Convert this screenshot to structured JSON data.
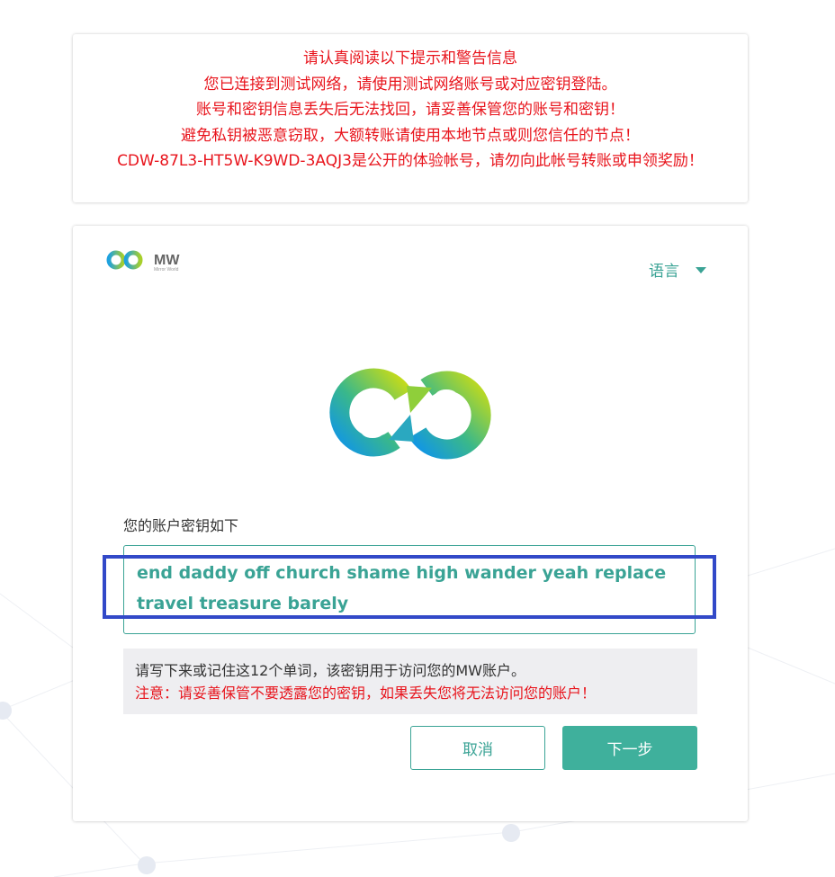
{
  "warning": {
    "lines": [
      "请认真阅读以下提示和警告信息",
      "您已连接到测试网络，请使用测试网络账号或对应密钥登陆。",
      "账号和密钥信息丢失后无法找回，请妥善保管您的账号和密钥！",
      "避免私钥被恶意窃取，大额转账请使用本地节点或则您信任的节点！",
      "CDW-87L3-HT5W-K9WD-3AQJ3是公开的体验帐号，请勿向此帐号转账或申领奖励！"
    ]
  },
  "brand": {
    "logo_text": "MW",
    "tagline": "Mirror World",
    "icon": "mirror-world-logo"
  },
  "language": {
    "label": "语言",
    "icon": "caret-down-icon"
  },
  "key": {
    "label": "您的账户密钥如下",
    "line1": "end daddy off church shame high wander yeah replace",
    "line2": "travel treasure barely"
  },
  "notice": {
    "line1": "请写下来或记住这12个单词，该密钥用于访问您的MW账户。",
    "line2": "注意：请妥善保管不要透露您的密钥，如果丢失您将无法访问您的账户！"
  },
  "buttons": {
    "cancel": "取消",
    "next": "下一步"
  },
  "colors": {
    "accent": "#3aa395",
    "warning": "#e8141c",
    "highlight": "#3249c8",
    "primary_button": "#3fb09c"
  }
}
